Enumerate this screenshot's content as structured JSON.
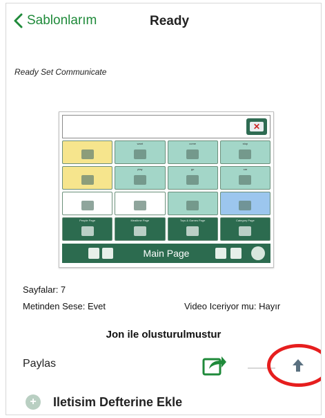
{
  "nav": {
    "back_label": "Sablonlarım",
    "title": "Ready"
  },
  "subtitle": "Ready Set Communicate",
  "preview": {
    "cells": [
      {
        "label": "",
        "bg": "c-y"
      },
      {
        "label": "want",
        "bg": "c-t"
      },
      {
        "label": "come",
        "bg": "c-t"
      },
      {
        "label": "stop",
        "bg": "c-t"
      },
      {
        "label": "",
        "bg": "c-y"
      },
      {
        "label": "play",
        "bg": "c-t"
      },
      {
        "label": "go",
        "bg": "c-t"
      },
      {
        "label": "car",
        "bg": "c-t"
      },
      {
        "label": "",
        "bg": "c-w"
      },
      {
        "label": "",
        "bg": "c-w"
      },
      {
        "label": "",
        "bg": "c-t"
      },
      {
        "label": "",
        "bg": "c-b"
      },
      {
        "label": "People Page",
        "bg": "c-g"
      },
      {
        "label": "Mealtime Page",
        "bg": "c-g"
      },
      {
        "label": "Toys & Games Page",
        "bg": "c-g"
      },
      {
        "label": "Category Page",
        "bg": "c-g"
      }
    ],
    "bottom_label": "Main Page"
  },
  "info": {
    "pages": "Sayfalar: 7",
    "tts": "Metinden Sese: Evet",
    "video": "Video Iceriyor mu: Hayır",
    "created_by": "Jon ile olusturulmustur"
  },
  "share": {
    "label": "Paylas"
  },
  "add_label": "Iletisim Defterine Ekle",
  "colors": {
    "accent": "#1f8a3a",
    "board_green": "#2c6b4f",
    "highlight": "#e61e1e"
  },
  "icons": {
    "back": "chevron-left-icon",
    "share": "share-icon",
    "upload": "upload-arrow-icon",
    "add": "plus-circle-icon",
    "clear": "clear-icon"
  }
}
